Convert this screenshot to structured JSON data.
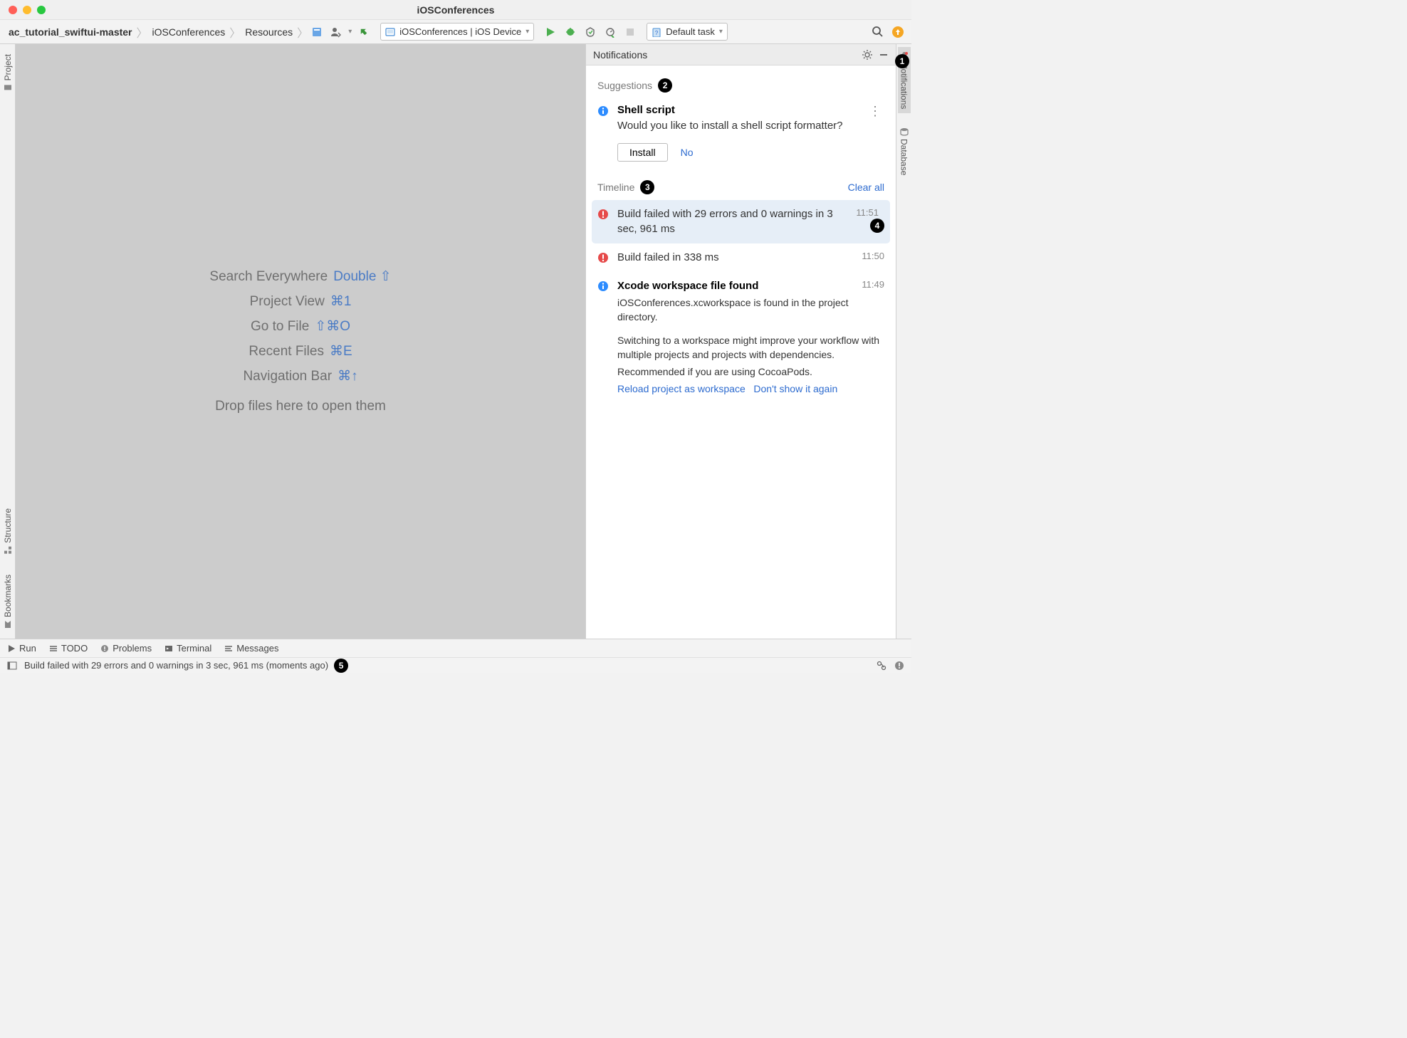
{
  "window": {
    "title": "iOSConferences"
  },
  "breadcrumb": {
    "items": [
      "ac_tutorial_swiftui-master",
      "iOSConferences",
      "Resources"
    ]
  },
  "toolbar": {
    "run_config": "iOSConferences | iOS Device",
    "task_config": "Default task"
  },
  "left_tabs": {
    "project": "Project",
    "structure": "Structure",
    "bookmarks": "Bookmarks"
  },
  "right_tabs": {
    "notifications": "Notifications",
    "database": "Database"
  },
  "editor_hints": [
    {
      "label": "Search Everywhere",
      "shortcut": "Double ⇧"
    },
    {
      "label": "Project View",
      "shortcut": "⌘1"
    },
    {
      "label": "Go to File",
      "shortcut": "⇧⌘O"
    },
    {
      "label": "Recent Files",
      "shortcut": "⌘E"
    },
    {
      "label": "Navigation Bar",
      "shortcut": "⌘↑"
    }
  ],
  "editor_dropfiles": "Drop files here to open them",
  "notifications": {
    "header": "Notifications",
    "suggestions_label": "Suggestions",
    "timeline_label": "Timeline",
    "clear_all": "Clear all",
    "suggestion": {
      "title": "Shell script",
      "text": "Would you like to install a shell script formatter?",
      "install": "Install",
      "no": "No"
    },
    "timeline": [
      {
        "type": "error",
        "title": "Build failed with 29 errors and 0 warnings in 3 sec, 961 ms",
        "time": "11:51",
        "highlighted": true
      },
      {
        "type": "error",
        "title": "Build failed in 338 ms",
        "time": "11:50"
      },
      {
        "type": "info",
        "title": "Xcode workspace file found",
        "bold": true,
        "time": "11:49",
        "body1": "iOSConferences.xcworkspace is found in the project directory.",
        "body2": "Switching to a workspace might improve your workflow with multiple projects and projects with dependencies.",
        "body3": "Recommended if you are using CocoaPods.",
        "link1": "Reload project as workspace",
        "link2": "Don't show it again"
      }
    ]
  },
  "bottom": {
    "run": "Run",
    "todo": "TODO",
    "problems": "Problems",
    "terminal": "Terminal",
    "messages": "Messages"
  },
  "status": {
    "text": "Build failed with 29 errors and 0 warnings in 3 sec, 961 ms (moments ago)"
  },
  "callouts": {
    "1": "1",
    "2": "2",
    "3": "3",
    "4": "4",
    "5": "5"
  }
}
